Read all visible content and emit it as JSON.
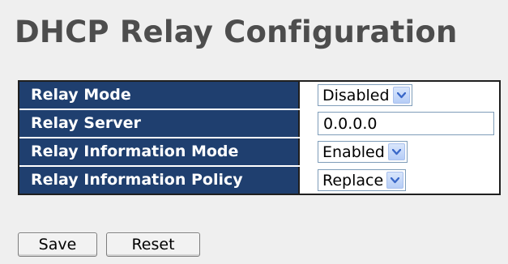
{
  "page": {
    "title": "DHCP Relay Configuration"
  },
  "settings": {
    "rows": [
      {
        "label": "Relay Mode",
        "control": "select",
        "value": "Disabled"
      },
      {
        "label": "Relay Server",
        "control": "text",
        "value": "0.0.0.0"
      },
      {
        "label": "Relay Information Mode",
        "control": "select",
        "value": "Enabled"
      },
      {
        "label": "Relay Information Policy",
        "control": "select",
        "value": "Replace"
      }
    ]
  },
  "buttons": {
    "save_label": "Save",
    "reset_label": "Reset"
  },
  "icons": {
    "dropdown": "chevron-down-icon"
  },
  "colors": {
    "header_background": "#1f3f6f",
    "page_background": "#efefef",
    "title_text": "#4d4d4d",
    "dropdown_arrow": "#3a68c8"
  }
}
